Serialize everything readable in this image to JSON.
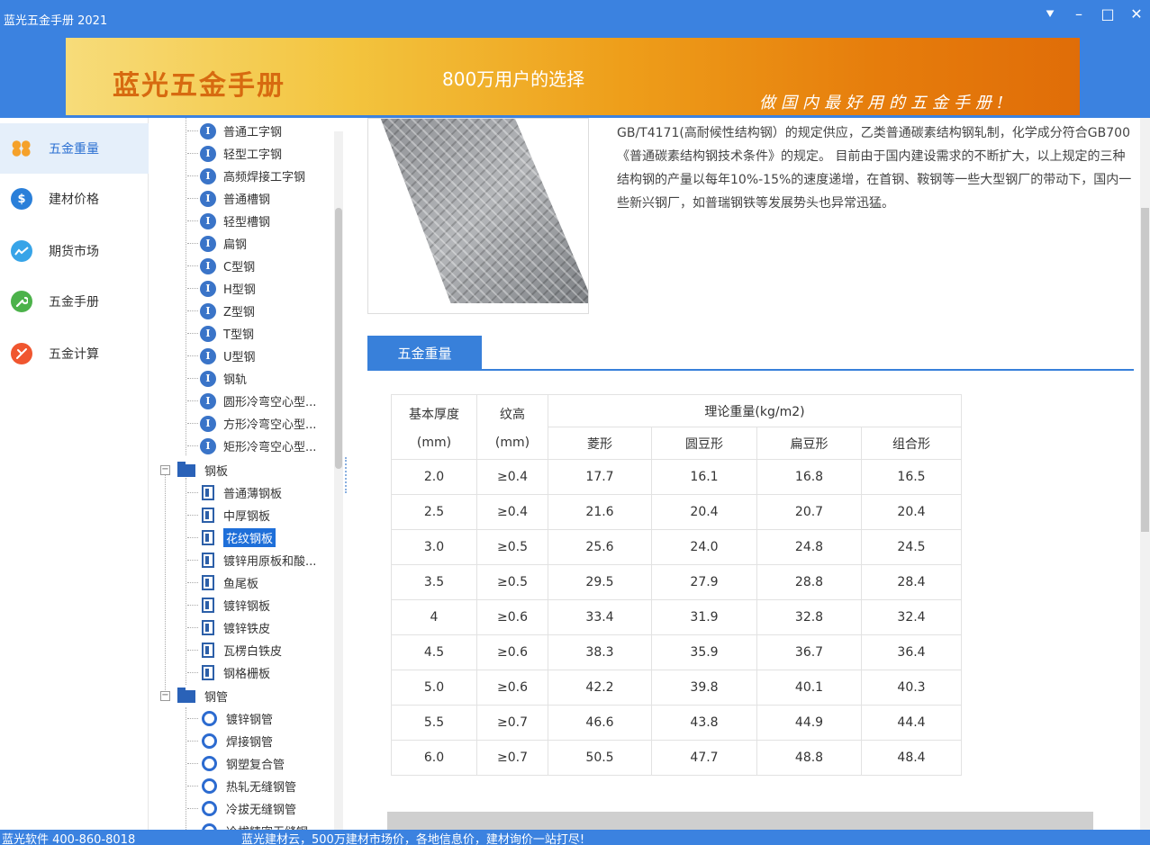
{
  "window": {
    "title": "蓝光五金手册 2021",
    "controls": [
      "⯆",
      "–",
      "□",
      "✕"
    ]
  },
  "banner": {
    "brand": "蓝光五金手册",
    "slogan": "800万用户的选择",
    "tagline": "做国内最好用的五金手册!"
  },
  "nav": {
    "items": [
      {
        "label": "五金重量",
        "icon": "weight-icon",
        "color": "#f5a12a"
      },
      {
        "label": "建材价格",
        "icon": "dollar-icon",
        "color": "#2a7fd9"
      },
      {
        "label": "期货市场",
        "icon": "trend-icon",
        "color": "#37a4e8"
      },
      {
        "label": "五金手册",
        "icon": "wrench-icon",
        "color": "#4cb24a"
      },
      {
        "label": "五金计算",
        "icon": "tools-icon",
        "color": "#f0562f"
      }
    ]
  },
  "tree": {
    "profile_items": [
      "普通工字钢",
      "轻型工字钢",
      "高频焊接工字钢",
      "普通槽钢",
      "轻型槽钢",
      "扁钢",
      "C型钢",
      "H型钢",
      "Z型钢",
      "T型钢",
      "U型钢",
      "钢轨",
      "圆形冷弯空心型...",
      "方形冷弯空心型...",
      "矩形冷弯空心型..."
    ],
    "plate_group": "钢板",
    "plate_items": [
      "普通薄钢板",
      "中厚钢板",
      "花纹钢板",
      "镀锌用原板和酸...",
      "鱼尾板",
      "镀锌钢板",
      "镀锌铁皮",
      "瓦楞白铁皮",
      "钢格栅板"
    ],
    "pipe_group": "钢管",
    "pipe_items": [
      "镀锌钢管",
      "焊接钢管",
      "钢塑复合管",
      "热轧无缝钢管",
      "冷拔无缝钢管",
      "冷拔精密无缝钢"
    ]
  },
  "content": {
    "description": "GB/T4171(高耐候性结构钢）的规定供应，乙类普通碳素结构钢轧制，化学成分符合GB700《普通碳素结构钢技术条件》的规定。 目前由于国内建设需求的不断扩大，以上规定的三种结构钢的产量以每年10%-15%的速度递增，在首钢、鞍钢等一些大型钢厂的带动下，国内一些新兴钢厂，如普瑞钢铁等发展势头也异常迅猛。",
    "section_tab": "五金重量",
    "table": {
      "header_thickness": "基本厚度",
      "header_thickness_unit": "(mm)",
      "header_rib": "纹高",
      "header_rib_unit": "(mm)",
      "header_weight": "理论重量(kg/m2)",
      "sub_headers": [
        "菱形",
        "圆豆形",
        "扁豆形",
        "组合形"
      ],
      "rows": [
        [
          "2.0",
          "≥0.4",
          "17.7",
          "16.1",
          "16.8",
          "16.5"
        ],
        [
          "2.5",
          "≥0.4",
          "21.6",
          "20.4",
          "20.7",
          "20.4"
        ],
        [
          "3.0",
          "≥0.5",
          "25.6",
          "24.0",
          "24.8",
          "24.5"
        ],
        [
          "3.5",
          "≥0.5",
          "29.5",
          "27.9",
          "28.8",
          "28.4"
        ],
        [
          "4",
          "≥0.6",
          "33.4",
          "31.9",
          "32.8",
          "32.4"
        ],
        [
          "4.5",
          "≥0.6",
          "38.3",
          "35.9",
          "36.7",
          "36.4"
        ],
        [
          "5.0",
          "≥0.6",
          "42.2",
          "39.8",
          "40.1",
          "40.3"
        ],
        [
          "5.5",
          "≥0.7",
          "46.6",
          "43.8",
          "44.9",
          "44.4"
        ],
        [
          "6.0",
          "≥0.7",
          "50.5",
          "47.7",
          "48.8",
          "48.4"
        ]
      ]
    }
  },
  "status": {
    "left": "蓝光软件 400-860-8018",
    "middle": "蓝光建材云，500万建材市场价，各地信息价，建材询价一站打尽!"
  }
}
